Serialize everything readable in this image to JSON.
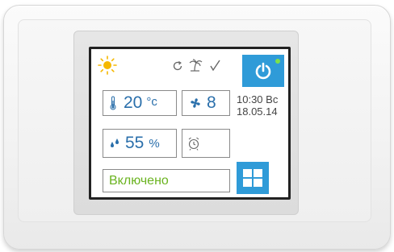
{
  "status": {
    "label": "Включено",
    "color": "#6ab31f"
  },
  "temperature": {
    "value": "20",
    "unit": "°c"
  },
  "fan": {
    "speed": "8"
  },
  "humidity": {
    "value": "55",
    "unit": "%"
  },
  "clock": {
    "time": "10:30 Вс",
    "date": "18.05.14"
  },
  "icons": {
    "mode": "sun-icon",
    "refresh": "refresh-icon",
    "vacation": "palm-icon",
    "check": "check-icon",
    "power": "power-icon",
    "menu": "menu-grid-icon",
    "alarm": "alarm-clock-icon",
    "thermometer": "thermometer-icon",
    "fan": "fan-icon",
    "humidity": "droplets-icon"
  },
  "colors": {
    "accent_blue": "#2f9bd8",
    "value_blue": "#2a6fab",
    "sun_yellow": "#f5b800",
    "indicator_green": "#7ee14a"
  }
}
